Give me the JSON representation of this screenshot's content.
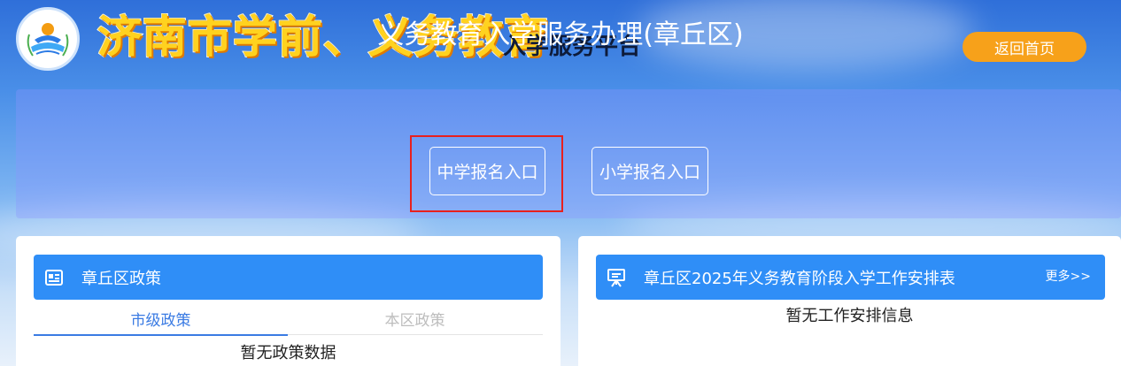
{
  "header": {
    "title": "济南市学前、义务教育",
    "subtitle": "入学服务平台",
    "home_button": "返回首页"
  },
  "banner": {
    "title": "义务教育入学服务办理(章丘区)",
    "middle_school_entry": "中学报名入口",
    "primary_school_entry": "小学报名入口"
  },
  "policy_panel": {
    "title": "章丘区政策",
    "tabs": [
      "市级政策",
      "本区政策"
    ],
    "active_tab": "市级政策",
    "empty_text": "暂无政策数据"
  },
  "schedule_panel": {
    "title": "章丘区2025年义务教育阶段入学工作安排表",
    "more_link": "更多>>",
    "empty_text": "暂无工作安排信息"
  },
  "colors": {
    "accent_blue": "#2f8ef7",
    "home_button": "#f7a11a",
    "brand_yellow": "#ffd21f",
    "highlight_red": "#e8201e",
    "active_tab": "#3a7be3"
  }
}
